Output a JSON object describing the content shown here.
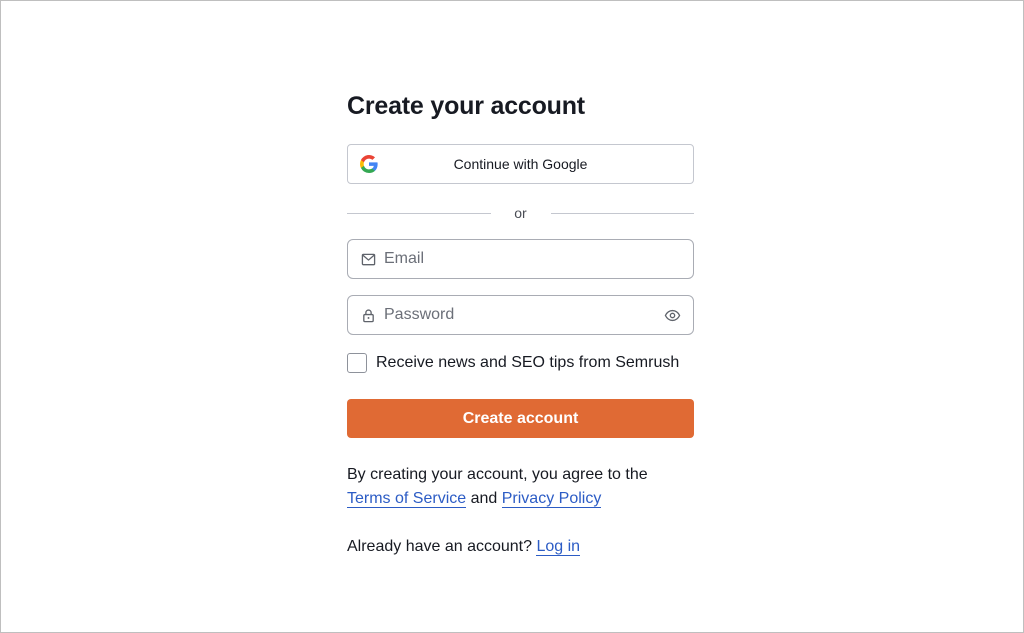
{
  "page": {
    "title": "Create your account"
  },
  "google": {
    "label": "Continue with Google",
    "icon": "google-g-icon"
  },
  "divider": {
    "text": "or"
  },
  "email": {
    "placeholder": "Email",
    "value": "",
    "icon": "mail-icon"
  },
  "password": {
    "placeholder": "Password",
    "value": "",
    "icon": "lock-icon",
    "toggle_icon": "eye-icon"
  },
  "newsletter": {
    "label": "Receive news and SEO tips from Semrush",
    "checked": false
  },
  "submit": {
    "label": "Create account"
  },
  "terms": {
    "prefix": "By creating your account, you agree to the",
    "tos_link": "Terms of Service",
    "conjunction": "and",
    "privacy_link": "Privacy Policy"
  },
  "login": {
    "prompt": "Already have an account?",
    "link": "Log in"
  },
  "colors": {
    "accent": "#e06a34",
    "link": "#2c5cc5",
    "border": "#a9acb4"
  }
}
